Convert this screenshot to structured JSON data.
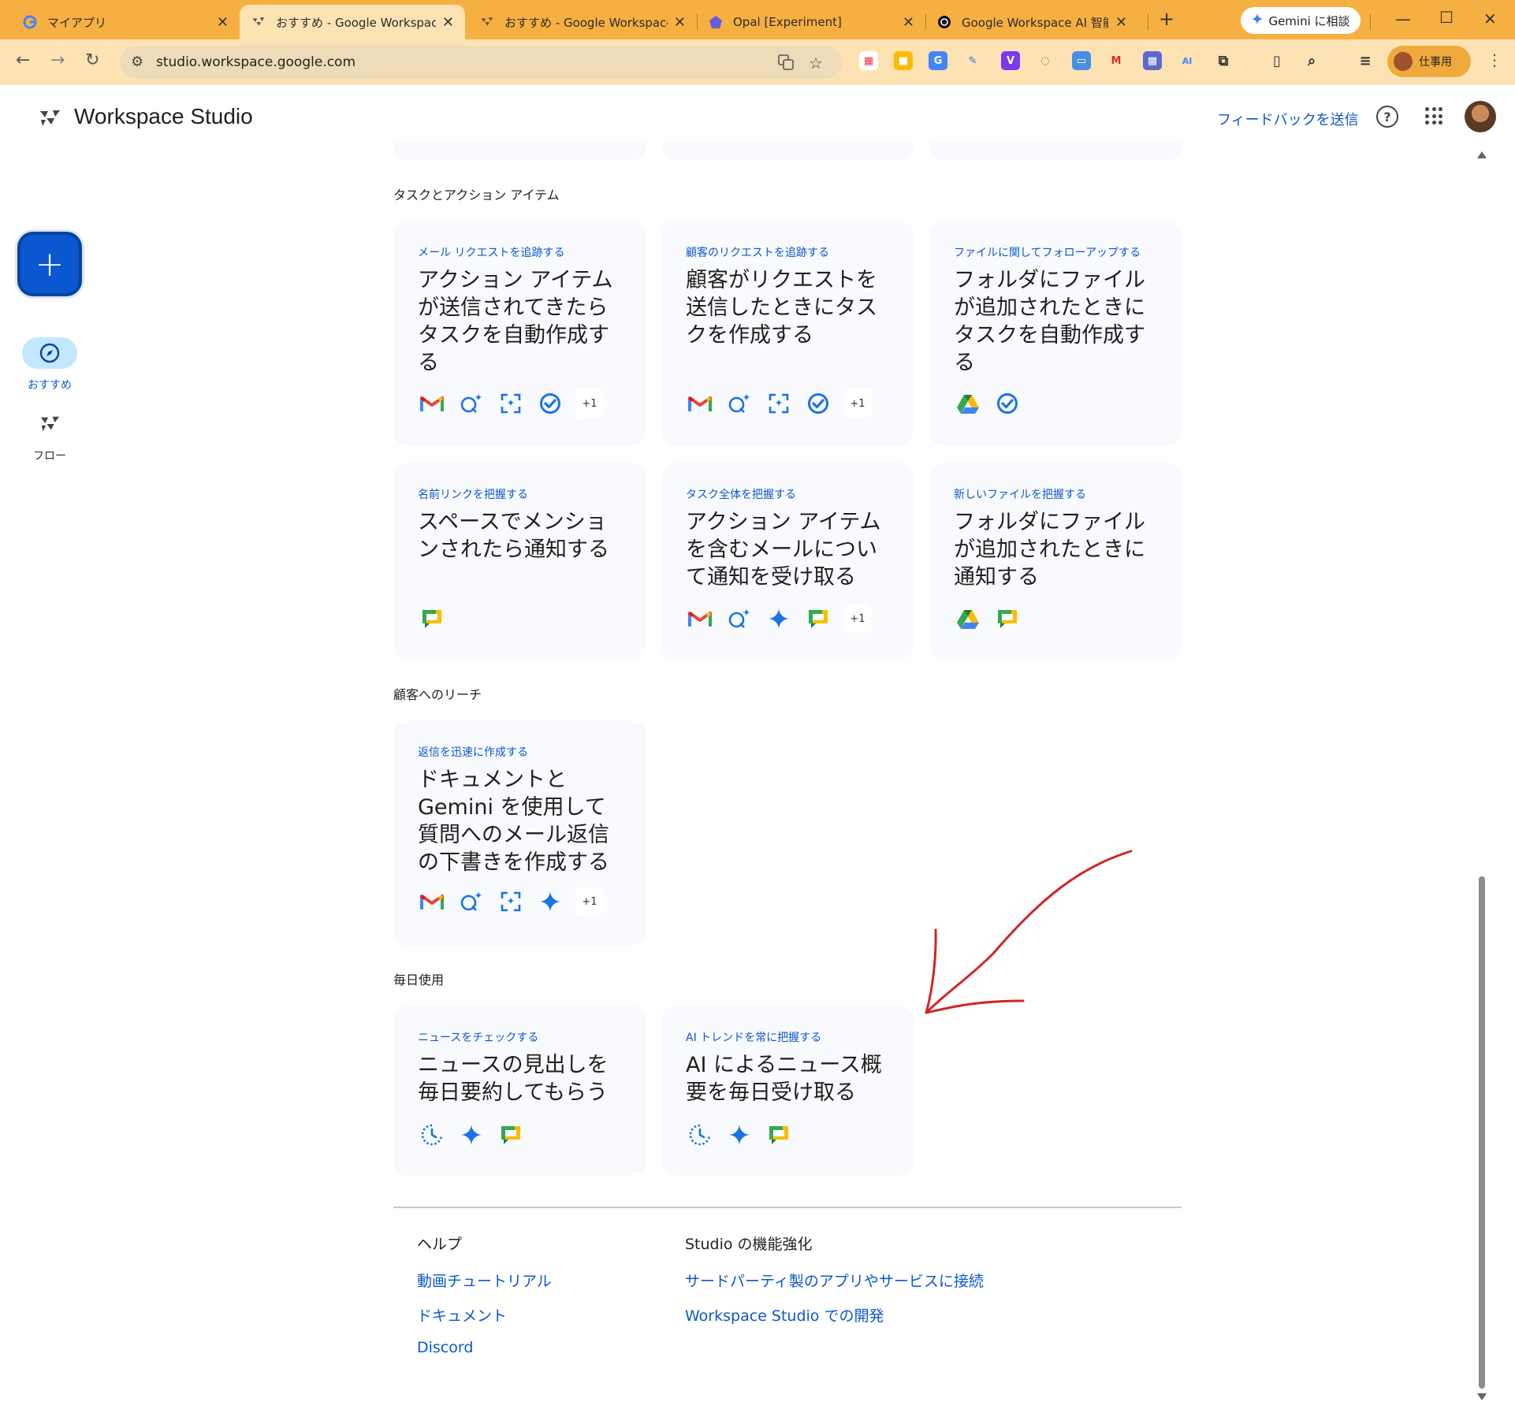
{
  "browser": {
    "tabs": [
      {
        "title": "マイアプリ",
        "favicon": "google-icon"
      },
      {
        "title": "おすすめ - Google Workspace S",
        "favicon": "workspace-studio-icon",
        "active": true
      },
      {
        "title": "おすすめ - Google Workspace S",
        "favicon": "workspace-studio-icon"
      },
      {
        "title": "Opal [Experiment]",
        "favicon": "opal-icon"
      },
      {
        "title": "Google Workspace AI 智能体平",
        "favicon": "openai-icon"
      }
    ],
    "new_tab": "+",
    "gemini_button": "Gemini に相談",
    "url": "studio.workspace.google.com",
    "profile_label": "仕事用"
  },
  "app": {
    "title": "Workspace Studio",
    "feedback": "フィードバックを送信",
    "help": "?"
  },
  "rail": {
    "fab": "+",
    "items": [
      {
        "label": "おすすめ",
        "icon": "compass-icon",
        "active": true
      },
      {
        "label": "フロー",
        "icon": "flows-icon"
      }
    ]
  },
  "sections": [
    {
      "title": "タスクとアクション アイテム",
      "cards": [
        {
          "subtitle": "メール リクエストを追跡する",
          "title": "アクション アイテムが送信されてきたらタスクを自動作成する",
          "icons": [
            "gmail",
            "ask-gemini",
            "extract",
            "tasks"
          ],
          "more": "+1"
        },
        {
          "subtitle": "顧客のリクエストを追跡する",
          "title": "顧客がリクエストを送信したときにタスクを作成する",
          "icons": [
            "gmail",
            "ask-gemini",
            "extract",
            "tasks"
          ],
          "more": "+1"
        },
        {
          "subtitle": "ファイルに関してフォローアップする",
          "title": "フォルダにファイルが追加されたときにタスクを自動作成する",
          "icons": [
            "drive",
            "tasks"
          ]
        },
        {
          "subtitle": "名前リンクを把握する",
          "title": "スペースでメンションされたら通知する",
          "icons": [
            "chat"
          ]
        },
        {
          "subtitle": "タスク全体を把握する",
          "title": "アクション アイテムを含むメールについて通知を受け取る",
          "icons": [
            "gmail",
            "ask-gemini",
            "gemini",
            "chat"
          ],
          "more": "+1"
        },
        {
          "subtitle": "新しいファイルを把握する",
          "title": "フォルダにファイルが追加されたときに通知する",
          "icons": [
            "drive",
            "chat"
          ]
        }
      ]
    },
    {
      "title": "顧客へのリーチ",
      "cards": [
        {
          "subtitle": "返信を迅速に作成する",
          "title": "ドキュメントと Gemini を使用して質問へのメール返信の下書きを作成する",
          "icons": [
            "gmail",
            "ask-gemini",
            "extract",
            "gemini"
          ],
          "more": "+1"
        }
      ]
    },
    {
      "title": "毎日使用",
      "cards": [
        {
          "subtitle": "ニュースをチェックする",
          "title": "ニュースの見出しを毎日要約してもらう",
          "icons": [
            "schedule",
            "gemini",
            "chat"
          ]
        },
        {
          "subtitle": "AI トレンドを常に把握する",
          "title": "AI によるニュース概要を毎日受け取る",
          "icons": [
            "schedule",
            "gemini",
            "chat"
          ]
        }
      ]
    }
  ],
  "footer": {
    "help_heading": "ヘルプ",
    "help_links": [
      "動画チュートリアル",
      "ドキュメント",
      "Discord"
    ],
    "power_heading": "Studio の機能強化",
    "power_links": [
      "サードパーティ製のアプリやサービスに接続",
      "Workspace Studio での開発"
    ]
  },
  "colors": {
    "accent": "#0b57d0",
    "tabbar": "#f6b042",
    "card_bg": "#f8fafd",
    "annotation": "#d22424"
  }
}
